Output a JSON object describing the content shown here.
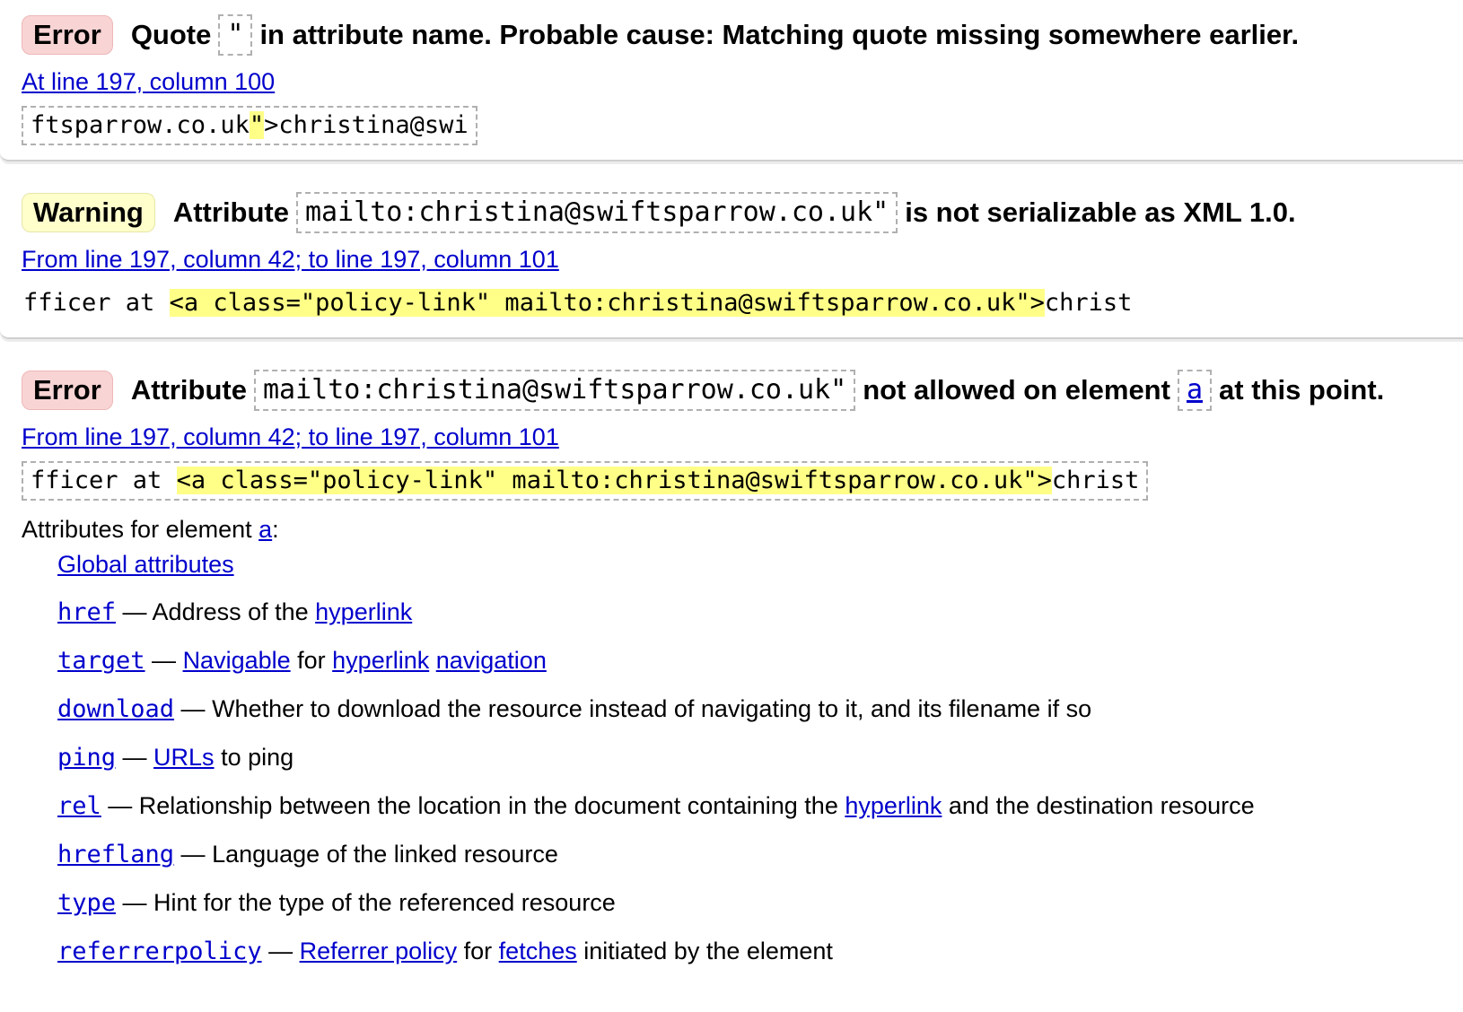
{
  "messages": [
    {
      "type": "Error",
      "text_before": "Quote",
      "code": "\"",
      "text_after": "in attribute name. Probable cause: Matching quote missing somewhere earlier.",
      "location": "At line 197, column 100",
      "extract_pre": "ftsparrow.co.uk",
      "extract_hl": "\"",
      "extract_post": ">christina@swi"
    },
    {
      "type": "Warning",
      "text_before": "Attribute",
      "code": "mailto:christina@swiftsparrow.co.uk\"",
      "text_after": "is not serializable as XML 1.0.",
      "location": "From line 197, column 42; to line 197, column 101",
      "extract_pre": "fficer at ",
      "extract_hl": "<a class=\"policy-link\" mailto:christina@swiftsparrow.co.uk\">",
      "extract_post": "christ"
    },
    {
      "type": "Error",
      "text_before": "Attribute",
      "code": "mailto:christina@swiftsparrow.co.uk\"",
      "text_mid": "not allowed on element",
      "element": "a",
      "text_after": "at this point.",
      "location": "From line 197, column 42; to line 197, column 101",
      "extract_pre": "fficer at ",
      "extract_hl": "<a class=\"policy-link\" mailto:christina@swiftsparrow.co.uk\">",
      "extract_post": "christ"
    }
  ],
  "attributes": {
    "title_prefix": "Attributes for element ",
    "element": "a",
    "title_suffix": ":",
    "global": "Global attributes",
    "items": [
      {
        "name": "href",
        "dash": " — ",
        "parts": [
          {
            "t": "Address of the "
          },
          {
            "link": "hyperlink"
          }
        ]
      },
      {
        "name": "target",
        "dash": " — ",
        "parts": [
          {
            "link": "Navigable"
          },
          {
            "t": " for "
          },
          {
            "link": "hyperlink"
          },
          {
            "t": " "
          },
          {
            "link": "navigation"
          }
        ]
      },
      {
        "name": "download",
        "dash": " — ",
        "parts": [
          {
            "t": "Whether to download the resource instead of navigating to it, and its filename if so"
          }
        ]
      },
      {
        "name": "ping",
        "dash": " — ",
        "parts": [
          {
            "link": "URLs"
          },
          {
            "t": " to ping"
          }
        ]
      },
      {
        "name": "rel",
        "dash": " — ",
        "parts": [
          {
            "t": "Relationship between the location in the document containing the "
          },
          {
            "link": "hyperlink"
          },
          {
            "t": " and the destination resource"
          }
        ]
      },
      {
        "name": "hreflang",
        "dash": " — ",
        "parts": [
          {
            "t": "Language of the linked resource"
          }
        ]
      },
      {
        "name": "type",
        "dash": " — ",
        "parts": [
          {
            "t": "Hint for the type of the referenced resource"
          }
        ]
      },
      {
        "name": "referrerpolicy",
        "dash": " — ",
        "parts": [
          {
            "link": "Referrer policy"
          },
          {
            "t": " for "
          },
          {
            "link": "fetches"
          },
          {
            "t": " initiated by the element"
          }
        ]
      }
    ]
  },
  "colors": {
    "link": "#0000cc",
    "highlight": "#ffff88",
    "error_badge": "#f9d4d4",
    "warning_badge": "#ffffcc"
  }
}
